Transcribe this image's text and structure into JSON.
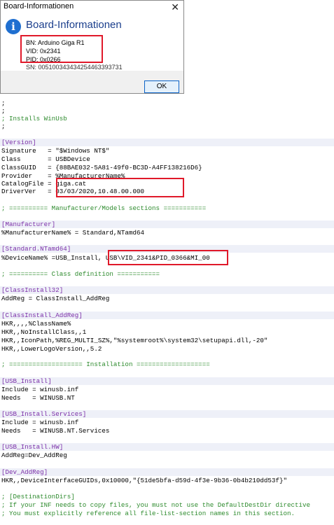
{
  "dialog": {
    "window_title": "Board-Informationen",
    "heading": "Board-Informationen",
    "bn": "BN: Arduino Giga R1",
    "vid": "VID: 0x2341",
    "pid": "PID: 0x0266",
    "sn": "SN: 005100343434254463393731",
    "close_glyph": "✕",
    "ok_label": "OK",
    "icon_glyph": "i"
  },
  "code": {
    "l01": ";",
    "l02": ";",
    "l03": "; Installs WinUsb",
    "l04": ";",
    "l05": "[Version]",
    "l06": "Signature   = \"$Windows NT$\"",
    "l07": "Class       = USBDevice",
    "l08": "ClassGUID   = {88BAE032-5A81-49f0-BC3D-A4FF138216D6}",
    "l09": "Provider    = %ManufacturerName%",
    "l10": "CatalogFile = giga.cat",
    "l11": "DriverVer   = 03/03/2020,10.48.00.000",
    "l12": "; ========== Manufacturer/Models sections ===========",
    "l13": "[Manufacturer]",
    "l14": "%ManufacturerName% = Standard,NTamd64",
    "l15": "[Standard.NTamd64]",
    "l16": "%DeviceName% =USB_Install, USB\\VID_2341&PID_0366&MI_00",
    "l17": "; ========== Class definition ===========",
    "l18": "[ClassInstall32]",
    "l19": "AddReg = ClassInstall_AddReg",
    "l20": "[ClassInstall_AddReg]",
    "l21": "HKR,,,,%ClassName%",
    "l22": "HKR,,NoInstallClass,,1",
    "l23": "HKR,,IconPath,%REG_MULTI_SZ%,\"%systemroot%\\system32\\setupapi.dll,-20\"",
    "l24": "HKR,,LowerLogoVersion,,5.2",
    "l25": "; =================== Installation ===================",
    "l26": "[USB_Install]",
    "l27": "Include = winusb.inf",
    "l28": "Needs   = WINUSB.NT",
    "l29": "[USB_Install.Services]",
    "l30": "Include = winusb.inf",
    "l31": "Needs   = WINUSB.NT.Services",
    "l32": "[USB_Install.HW]",
    "l33": "AddReg=Dev_AddReg",
    "l34": "[Dev_AddReg]",
    "l35": "HKR,,DeviceInterfaceGUIDs,0x10000,\"{51de5bfa-d59d-4f3e-9b36-0b4b210dd53f}\"",
    "l36": "; [DestinationDirs]",
    "l37": "; If your INF needs to copy files, you must not use the DefaultDestDir directive",
    "l38": "; You must explicitly reference all file-list-section names in this section."
  },
  "colors": {
    "highlight_box": "#e0192a",
    "comment": "#2e8b2e",
    "section": "#7b2fa8"
  }
}
